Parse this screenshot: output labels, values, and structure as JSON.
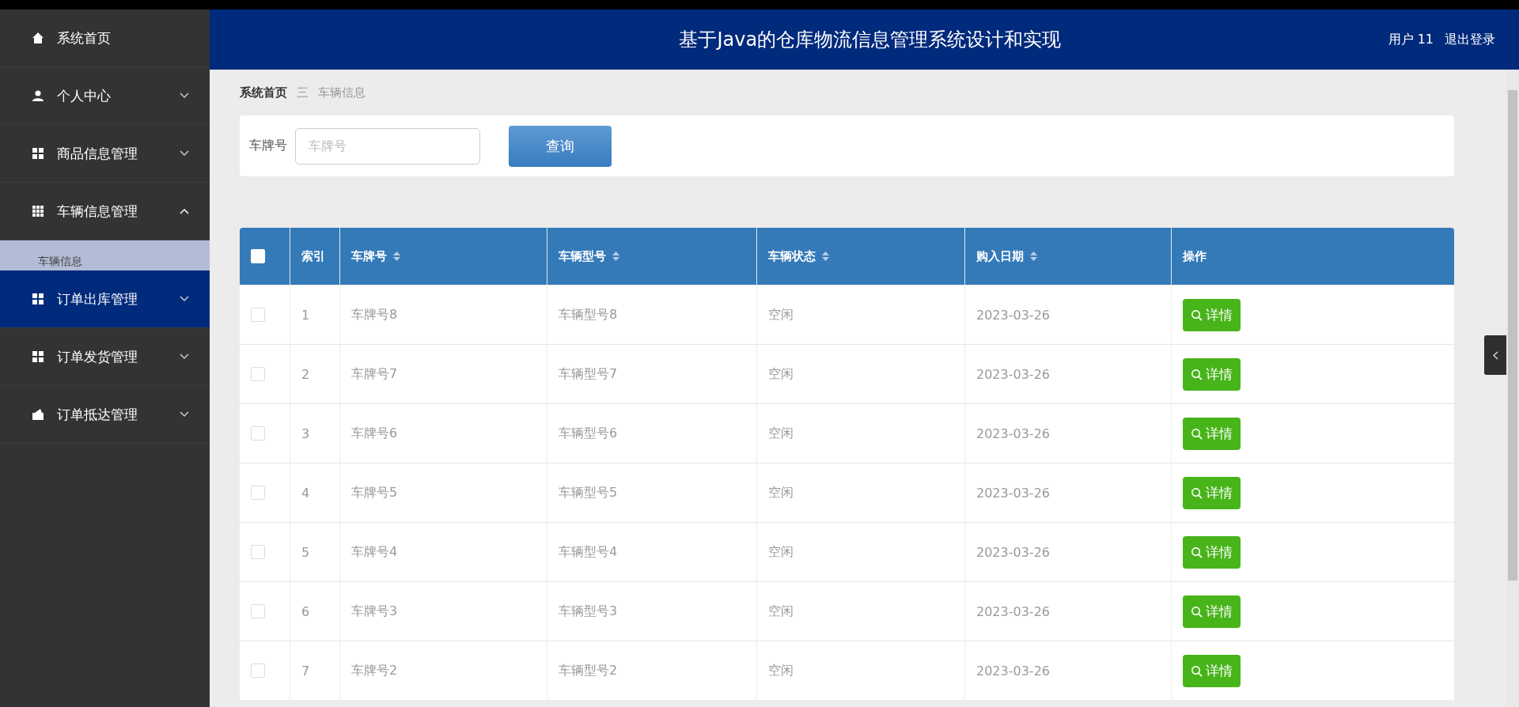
{
  "header": {
    "title": "基于Java的仓库物流信息管理系统设计和实现",
    "user": "用户 11",
    "logout": "退出登录"
  },
  "sidebar": {
    "items": [
      {
        "label": "系统首页",
        "selected": false
      },
      {
        "label": "个人中心",
        "expanded": false,
        "selected": false
      },
      {
        "label": "商品信息管理",
        "expanded": false,
        "selected": false
      },
      {
        "label": "车辆信息管理",
        "expanded": true,
        "selected": false,
        "children": [
          {
            "label": "车辆信息"
          }
        ]
      },
      {
        "label": "订单出库管理",
        "expanded": false,
        "selected": true
      },
      {
        "label": "订单发货管理",
        "expanded": false,
        "selected": false
      },
      {
        "label": "订单抵达管理",
        "expanded": false,
        "selected": false
      }
    ]
  },
  "breadcrumb": {
    "home": "系统首页",
    "separator": "三",
    "current": "车辆信息"
  },
  "search": {
    "label": "车牌号",
    "placeholder": "车牌号",
    "button": "查询"
  },
  "table": {
    "select_all": {
      "checked": false
    },
    "columns": [
      {
        "label": "索引",
        "sortable": false
      },
      {
        "label": "车牌号",
        "sortable": true
      },
      {
        "label": "车辆型号",
        "sortable": true
      },
      {
        "label": "车辆状态",
        "sortable": true
      },
      {
        "label": "购入日期",
        "sortable": true
      },
      {
        "label": "操作",
        "sortable": false
      }
    ],
    "rows": [
      {
        "checked": false,
        "cells": [
          "1",
          "车牌号8",
          "车辆型号8",
          "空闲",
          "2023-03-26"
        ],
        "action": "详情"
      },
      {
        "checked": false,
        "cells": [
          "2",
          "车牌号7",
          "车辆型号7",
          "空闲",
          "2023-03-26"
        ],
        "action": "详情"
      },
      {
        "checked": false,
        "cells": [
          "3",
          "车牌号6",
          "车辆型号6",
          "空闲",
          "2023-03-26"
        ],
        "action": "详情"
      },
      {
        "checked": false,
        "cells": [
          "4",
          "车牌号5",
          "车辆型号5",
          "空闲",
          "2023-03-26"
        ],
        "action": "详情"
      },
      {
        "checked": false,
        "cells": [
          "5",
          "车牌号4",
          "车辆型号4",
          "空闲",
          "2023-03-26"
        ],
        "action": "详情"
      },
      {
        "checked": false,
        "cells": [
          "6",
          "车牌号3",
          "车辆型号3",
          "空闲",
          "2023-03-26"
        ],
        "action": "详情"
      },
      {
        "checked": false,
        "cells": [
          "7",
          "车牌号2",
          "车辆型号2",
          "空闲",
          "2023-03-26"
        ],
        "action": "详情"
      }
    ]
  }
}
